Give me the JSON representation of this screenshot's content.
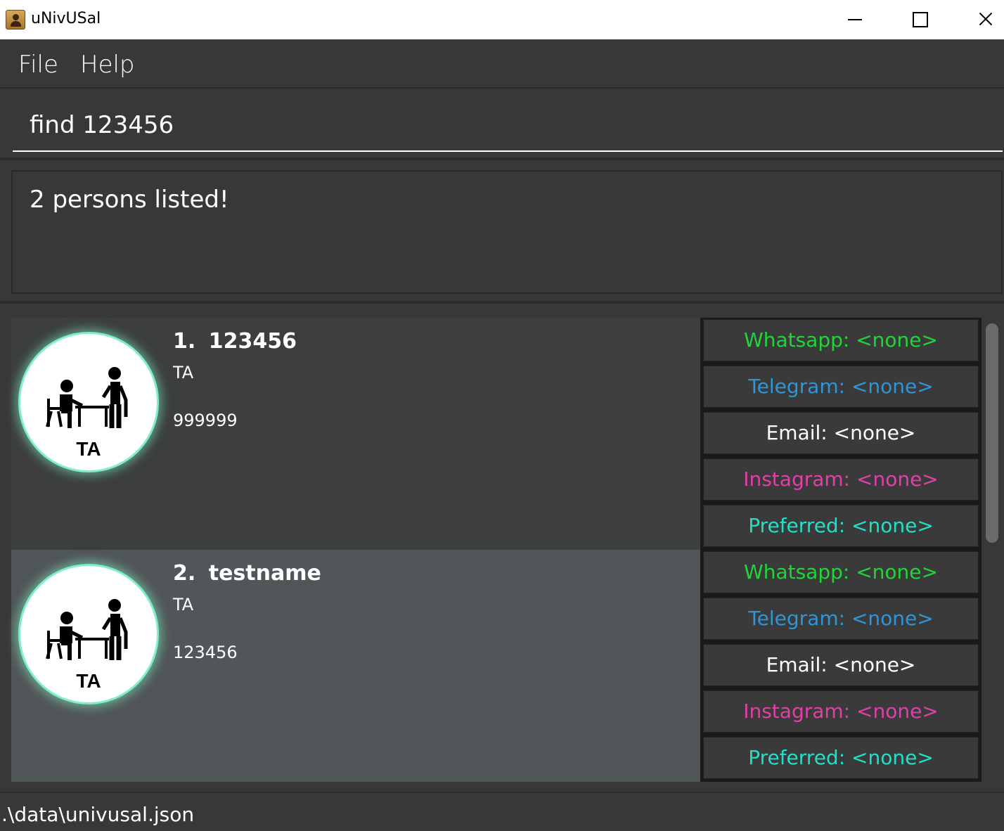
{
  "window": {
    "title": "uNivUSal",
    "icon": "address-book-icon"
  },
  "menu": {
    "file": "File",
    "help": "Help"
  },
  "command": {
    "value": "find 123456"
  },
  "result": {
    "message": "2 persons listed!"
  },
  "persons": [
    {
      "index": "1.",
      "name": "123456",
      "role": "TA",
      "phone": "999999",
      "avatar_label": "TA",
      "contacts": {
        "whatsapp": "Whatsapp: <none>",
        "telegram": "Telegram: <none>",
        "email": "Email: <none>",
        "instagram": "Instagram: <none>",
        "preferred": "Preferred: <none>"
      }
    },
    {
      "index": "2.",
      "name": "testname",
      "role": "TA",
      "phone": "123456",
      "avatar_label": "TA",
      "contacts": {
        "whatsapp": "Whatsapp: <none>",
        "telegram": "Telegram: <none>",
        "email": "Email: <none>",
        "instagram": "Instagram: <none>",
        "preferred": "Preferred: <none>"
      }
    }
  ],
  "status": {
    "file_path": ".\\data\\univusal.json"
  },
  "colors": {
    "whatsapp": "#1fd638",
    "telegram": "#2e95d8",
    "email": "#ffffff",
    "instagram": "#e040a8",
    "preferred": "#20e0c8",
    "avatar_glow": "#7ff0c4"
  }
}
